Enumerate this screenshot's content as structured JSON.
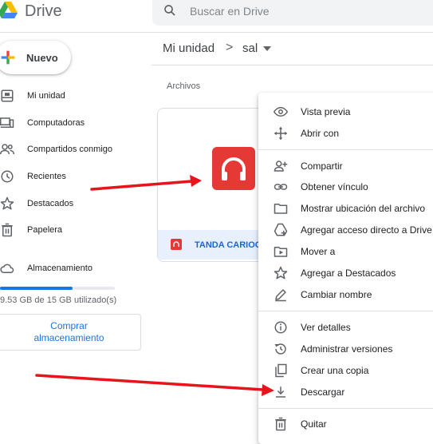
{
  "app": {
    "title": "Drive"
  },
  "search": {
    "placeholder": "Buscar en Drive"
  },
  "new_button": {
    "label": "Nuevo"
  },
  "sidebar": {
    "items": [
      {
        "label": "Mi unidad",
        "icon": "my-drive-icon"
      },
      {
        "label": "Computadoras",
        "icon": "computer-icon"
      },
      {
        "label": "Compartidos conmigo",
        "icon": "shared-icon"
      },
      {
        "label": "Recientes",
        "icon": "clock-icon"
      },
      {
        "label": "Destacados",
        "icon": "star-icon"
      },
      {
        "label": "Papelera",
        "icon": "trash-icon"
      }
    ],
    "storage": {
      "label": "Almacenamiento",
      "used_text": "9.53 GB de 15 GB utilizado(s)",
      "used_fraction": 0.635,
      "buy_label": "Comprar almacenamiento"
    }
  },
  "breadcrumb": {
    "root": "Mi unidad",
    "separator": ">",
    "current": "sal"
  },
  "main": {
    "section_title": "Archivos",
    "files": [
      {
        "name": "TANDA CARIOCA"
      }
    ]
  },
  "context_menu": {
    "items": [
      {
        "label": "Vista previa",
        "icon": "eye-icon"
      },
      {
        "label": "Abrir con",
        "icon": "move-arrows-icon"
      },
      {
        "label": "Compartir",
        "icon": "person-add-icon"
      },
      {
        "label": "Obtener vínculo",
        "icon": "link-icon"
      },
      {
        "label": "Mostrar ubicación del archivo",
        "icon": "folder-icon"
      },
      {
        "label": "Agregar acceso directo a Drive",
        "icon": "drive-shortcut-icon"
      },
      {
        "label": "Mover a",
        "icon": "move-to-icon"
      },
      {
        "label": "Agregar a Destacados",
        "icon": "star-outline-icon"
      },
      {
        "label": "Cambiar nombre",
        "icon": "pencil-icon"
      },
      {
        "label": "Ver detalles",
        "icon": "info-icon"
      },
      {
        "label": "Administrar versiones",
        "icon": "history-icon"
      },
      {
        "label": "Crear una copia",
        "icon": "copy-icon"
      },
      {
        "label": "Descargar",
        "icon": "download-icon"
      },
      {
        "label": "Quitar",
        "icon": "trash-icon"
      }
    ]
  },
  "colors": {
    "accent": "#1a73e8",
    "annotation_arrow": "#e8141b",
    "file_icon": "#e53935"
  }
}
